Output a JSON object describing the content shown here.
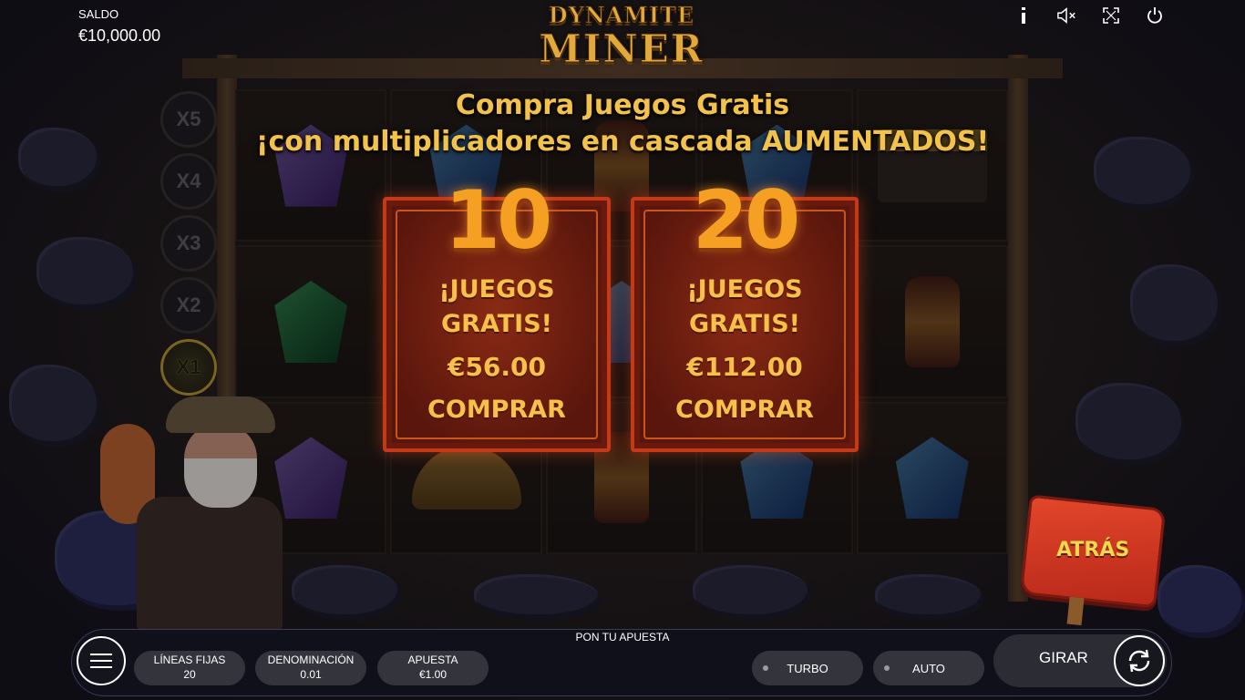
{
  "header": {
    "balance_label": "SALDO",
    "balance_value": "€10,000.00",
    "logo_line1": "DYNAMITE",
    "logo_line2": "MINER",
    "icons": [
      "info-icon",
      "sound-muted-icon",
      "fullscreen-icon",
      "power-icon"
    ]
  },
  "multipliers": [
    "X5",
    "X4",
    "X3",
    "X2",
    "X1"
  ],
  "active_multiplier": "X1",
  "popup": {
    "headline_1": "Compra Juegos Gratis",
    "headline_2": "¡con multiplicadores en cascada AUMENTADOS!",
    "offers": [
      {
        "count": "10",
        "line1": "¡JUEGOS",
        "line2": "GRATIS!",
        "price": "€56.00",
        "buy_label": "COMPRAR"
      },
      {
        "count": "20",
        "line1": "¡JUEGOS",
        "line2": "GRATIS!",
        "price": "€112.00",
        "buy_label": "COMPRAR"
      }
    ],
    "back_label": "ATRÁS"
  },
  "bottom_bar": {
    "title": "PON TU APUESTA",
    "lines_label": "LÍNEAS FIJAS",
    "lines_value": "20",
    "denom_label": "DENOMINACIÓN",
    "denom_value": "0.01",
    "bet_label": "APUESTA",
    "bet_value": "€1.00",
    "turbo_label": "TURBO",
    "auto_label": "AUTO",
    "spin_label": "GIRAR"
  },
  "colors": {
    "gold_text": "#f2c24a",
    "offer_border": "#c43a18",
    "offer_fill": "#8a2a14",
    "bar_bg": "#10101c"
  }
}
